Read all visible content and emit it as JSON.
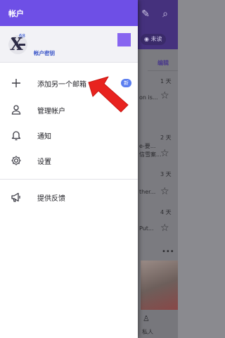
{
  "drawer": {
    "title": "帐户",
    "account": {
      "badge_count": "68",
      "key_label": "帐户密钥"
    },
    "items": [
      {
        "label": "添加另一个邮箱",
        "icon": "plus-icon",
        "badge": "新"
      },
      {
        "label": "管理帐户",
        "icon": "person-icon"
      },
      {
        "label": "通知",
        "icon": "bell-icon"
      },
      {
        "label": "设置",
        "icon": "gear-icon"
      },
      {
        "label": "提供反馈",
        "icon": "megaphone-icon"
      }
    ]
  },
  "background": {
    "filter_unread": "未读",
    "edit_label": "编辑",
    "snippets": [
      "1 天",
      "on is...",
      "2 天",
      "e-要...",
      "信雪案...",
      "3 天",
      "ther...",
      "4 天",
      "Put...",
      "私人"
    ]
  },
  "colors": {
    "drawer_header": "#6e4fe6",
    "accent_square": "#8765f0",
    "arrow": "#e8231f",
    "badge": "#5b7ef0"
  }
}
